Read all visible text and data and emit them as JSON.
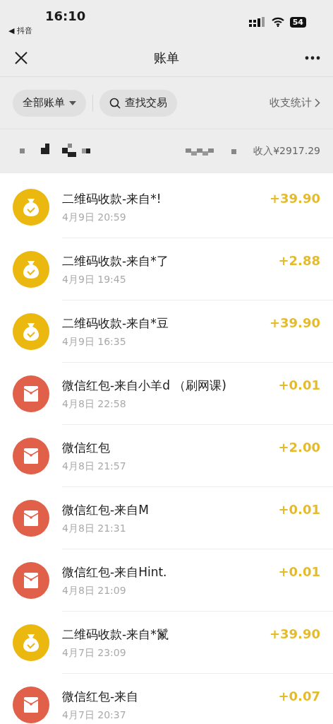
{
  "status_bar": {
    "time": "16:10",
    "back_app": "◀ 抖音",
    "battery": "54"
  },
  "nav": {
    "title": "账单"
  },
  "filters": {
    "all_bills": "全部账单",
    "search": "查找交易",
    "stats": "收支统计"
  },
  "summary": {
    "income": "收入¥2917.29"
  },
  "transactions": [
    {
      "kind": "qrcode",
      "title": "二维码收款-来自*!",
      "time": "4月9日 20:59",
      "amount": "+39.90"
    },
    {
      "kind": "qrcode",
      "title": "二维码收款-来自*了",
      "time": "4月9日 19:45",
      "amount": "+2.88"
    },
    {
      "kind": "qrcode",
      "title": "二维码收款-来自*豆",
      "time": "4月9日 16:35",
      "amount": "+39.90"
    },
    {
      "kind": "redpacket",
      "title": "微信红包-来自小羊d （刷网课)",
      "time": "4月8日 22:58",
      "amount": "+0.01"
    },
    {
      "kind": "redpacket",
      "title": "微信红包",
      "time": "4月8日 21:57",
      "amount": "+2.00"
    },
    {
      "kind": "redpacket",
      "title": "微信红包-来自M",
      "time": "4月8日 21:31",
      "amount": "+0.01"
    },
    {
      "kind": "redpacket",
      "title": "微信红包-来自Hint.",
      "time": "4月8日 21:09",
      "amount": "+0.01"
    },
    {
      "kind": "qrcode",
      "title": "二维码收款-来自*鬣",
      "time": "4月7日 23:09",
      "amount": "+39.90"
    },
    {
      "kind": "redpacket",
      "title": "微信红包-来自",
      "time": "4月7日 20:37",
      "amount": "+0.07"
    }
  ]
}
